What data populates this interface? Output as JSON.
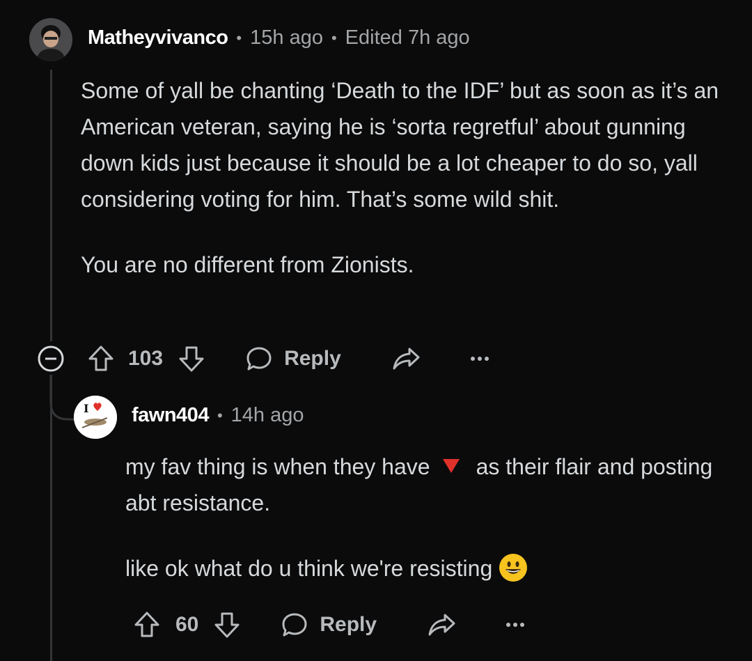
{
  "comment": {
    "username": "Matheyvivanco",
    "time": "15h ago",
    "edited": "Edited 7h ago",
    "paragraph1": "Some of yall be chanting ‘Death to the IDF’ but as soon as it’s an American veteran, saying he is ‘sorta regretful’ about gunning down kids just because it should be a lot cheaper to do so, yall considering voting for him. That’s some wild shit.",
    "paragraph2": "You are no different from Zionists.",
    "votes": "103",
    "reply_label": "Reply",
    "avatar_icon": "user-avatar-icon"
  },
  "reply": {
    "username": "fawn404",
    "time": "14h ago",
    "text_before_flag": "my fav thing is when they have",
    "flag_icon": "red-triangle-icon",
    "text_after_flag": "as their flair and posting abt resistance.",
    "paragraph2": "like ok what do u think we're resisting",
    "emoji_icon": "grinning-face-icon",
    "votes": "60",
    "reply_label": "Reply",
    "avatar_icon": "i-heart-avatar-icon"
  },
  "colors": {
    "background": "#0b0b0c",
    "text": "#d7dadc",
    "muted": "#a3a6a8",
    "thread_line": "#343536",
    "flair_red": "#e0312a",
    "emoji_yellow": "#f7c41f"
  }
}
